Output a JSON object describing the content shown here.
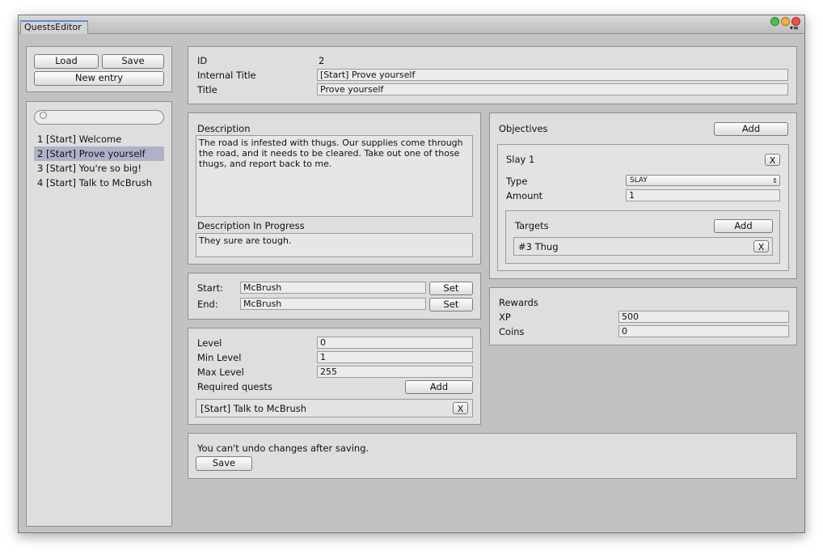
{
  "window": {
    "tab_title": "QuestsEditor"
  },
  "sidebar": {
    "load_label": "Load",
    "save_label": "Save",
    "new_entry_label": "New entry",
    "search_placeholder": "",
    "items": [
      {
        "label": "1 [Start] Welcome",
        "selected": false
      },
      {
        "label": "2 [Start] Prove yourself",
        "selected": true
      },
      {
        "label": "3 [Start] You're so big!",
        "selected": false
      },
      {
        "label": "4 [Start] Talk to McBrush",
        "selected": false
      }
    ]
  },
  "header": {
    "id_label": "ID",
    "id_value": "2",
    "internal_title_label": "Internal Title",
    "internal_title_value": "[Start] Prove yourself",
    "title_label": "Title",
    "title_value": "Prove yourself"
  },
  "description": {
    "label": "Description",
    "value": "The road is infested with thugs. Our supplies come through the road, and it needs to be cleared. Take out one of those thugs, and report back to me.",
    "in_progress_label": "Description In Progress",
    "in_progress_value": "They sure are tough."
  },
  "npcs": {
    "start_label": "Start:",
    "start_value": "McBrush",
    "end_label": "End:",
    "end_value": "McBrush",
    "set_label": "Set"
  },
  "levels": {
    "level_label": "Level",
    "level_value": "0",
    "min_label": "Min Level",
    "min_value": "1",
    "max_label": "Max Level",
    "max_value": "255",
    "required_label": "Required quests",
    "add_label": "Add",
    "required_items": [
      {
        "label": "[Start] Talk to McBrush",
        "remove": "X"
      }
    ]
  },
  "objectives": {
    "label": "Objectives",
    "add_label": "Add",
    "items": [
      {
        "name": "Slay 1",
        "remove": "X",
        "type_label": "Type",
        "type_value": "SLAY",
        "amount_label": "Amount",
        "amount_value": "1",
        "targets_label": "Targets",
        "targets_add": "Add",
        "targets": [
          {
            "label": "#3 Thug",
            "remove": "X"
          }
        ]
      }
    ]
  },
  "rewards": {
    "label": "Rewards",
    "xp_label": "XP",
    "xp_value": "500",
    "coins_label": "Coins",
    "coins_value": "0"
  },
  "footer": {
    "warning": "You can't undo changes after saving.",
    "save_label": "Save"
  },
  "colors": {
    "selection": "#aeb2c9",
    "panel": "#dedede",
    "window": "#c2c2c2",
    "traffic_green": "#4cc04c",
    "traffic_yellow": "#f2b33a",
    "traffic_red": "#ef4f48"
  }
}
